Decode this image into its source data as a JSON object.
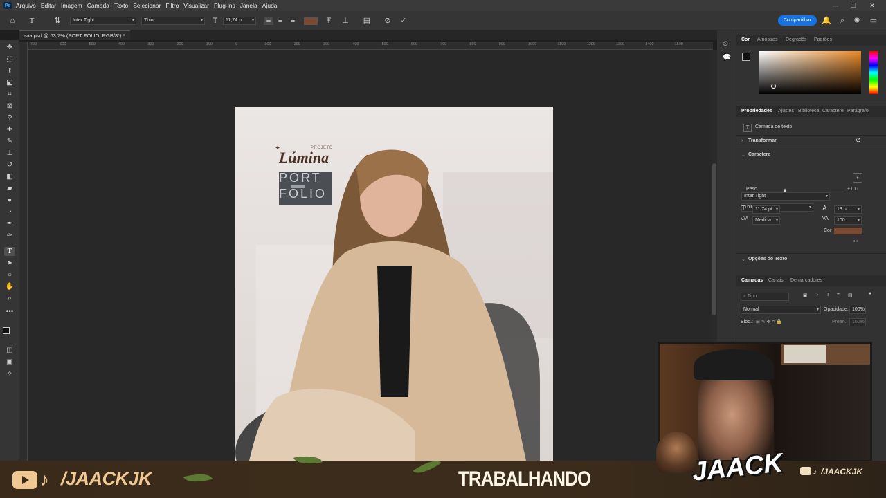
{
  "menubar": {
    "app_icon": "Ps",
    "items": [
      "Arquivo",
      "Editar",
      "Imagem",
      "Camada",
      "Texto",
      "Selecionar",
      "Filtro",
      "Visualizar",
      "Plug-ins",
      "Janela",
      "Ajuda"
    ]
  },
  "options_bar": {
    "font_family": "Inter Tight",
    "font_style": "Thin",
    "font_size": "11,74 pt",
    "share_label": "Compartilhar"
  },
  "document": {
    "tab_title": "aaa.psd @ 63,7% (PORT FÓLIO, RGB/8*) *",
    "ruler_labels": [
      "700",
      "600",
      "500",
      "400",
      "300",
      "200",
      "100",
      "0",
      "100",
      "200",
      "300",
      "400",
      "500",
      "600",
      "700",
      "800",
      "900",
      "1000",
      "1100",
      "1200",
      "1300",
      "1400",
      "1500"
    ]
  },
  "artwork": {
    "logo_small": "PROJETO",
    "logo_main": "Lúmina",
    "port_line1": "PORT",
    "port_line2": "FÓLIO"
  },
  "color_panel": {
    "tabs": [
      "Cor",
      "Amostras",
      "Degradês",
      "Padrões"
    ],
    "active_tab": "Cor"
  },
  "properties_panel": {
    "tabs": [
      "Propriedades",
      "Ajustes",
      "Biblioteca",
      "Caractere",
      "Parágrafo"
    ],
    "layer_type": "Camada de texto",
    "transform_label": "Transformar",
    "character_label": "Caractere",
    "font_family": "Inter Tight",
    "font_style": "Thin",
    "weight_label": "Peso",
    "weight_value": "+100",
    "size_value": "11,74 pt",
    "leading_value": "13 pt",
    "kerning_value": "Medida",
    "tracking_value": "100",
    "color_label": "Cor",
    "color_value": "#8a5a40",
    "text_options_label": "Opções do Texto",
    "more": "•••"
  },
  "layers_panel": {
    "tabs": [
      "Camadas",
      "Canais",
      "Demarcadores"
    ],
    "search_placeholder": "Tipo",
    "blend_mode": "Normal",
    "opacity_label": "Opacidade:",
    "opacity_value": "100%",
    "lock_label": "Bloq.:",
    "fill_label": "Preen.:",
    "fill_value": "100%"
  },
  "stream_overlay": {
    "handle": "/JAACKJK",
    "status": "TRABALHANDO",
    "logo_text": "JAACK",
    "handle_small": "/JAACKJK"
  }
}
